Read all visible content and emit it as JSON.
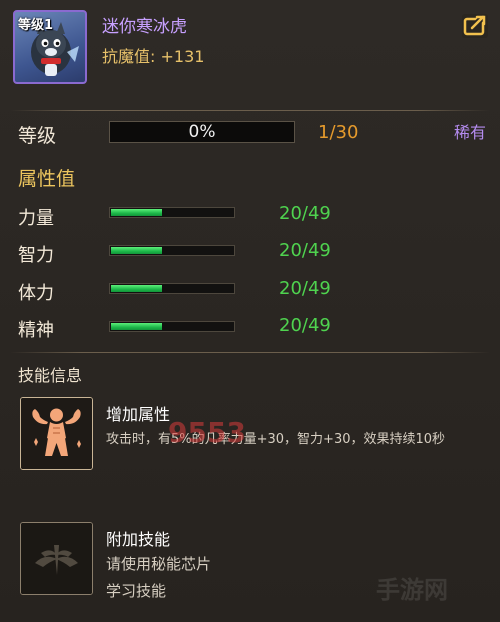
{
  "pet": {
    "level_tag": "等级1",
    "name": "迷你寒冰虎",
    "resist_label": "抗魔值:",
    "resist_value": "+131",
    "rarity": "稀有"
  },
  "level": {
    "label": "等级",
    "progress_text": "0%",
    "progress": 0,
    "count": "1/30"
  },
  "attributes": {
    "title": "属性值",
    "items": [
      {
        "label": "力量",
        "value": "20/49",
        "fill": 0.41
      },
      {
        "label": "智力",
        "value": "20/49",
        "fill": 0.41
      },
      {
        "label": "体力",
        "value": "20/49",
        "fill": 0.41
      },
      {
        "label": "精神",
        "value": "20/49",
        "fill": 0.41
      }
    ]
  },
  "skills": {
    "title": "技能信息",
    "items": [
      {
        "name": "增加属性",
        "desc": "攻击时，有5%的几率力量+30，智力+30，效果持续10秒",
        "icon": "muscle-man-icon"
      },
      {
        "name": "附加技能",
        "desc": "请使用秘能芯片",
        "desc2": "学习技能",
        "icon": "empty-skill-slot-icon"
      }
    ]
  },
  "colors": {
    "name_purple": "#c7a0ff",
    "gold": "#e7c16a",
    "green": "#4fd34f",
    "orange": "#e59a2c"
  },
  "watermarks": [
    "9553",
    "手游网"
  ]
}
